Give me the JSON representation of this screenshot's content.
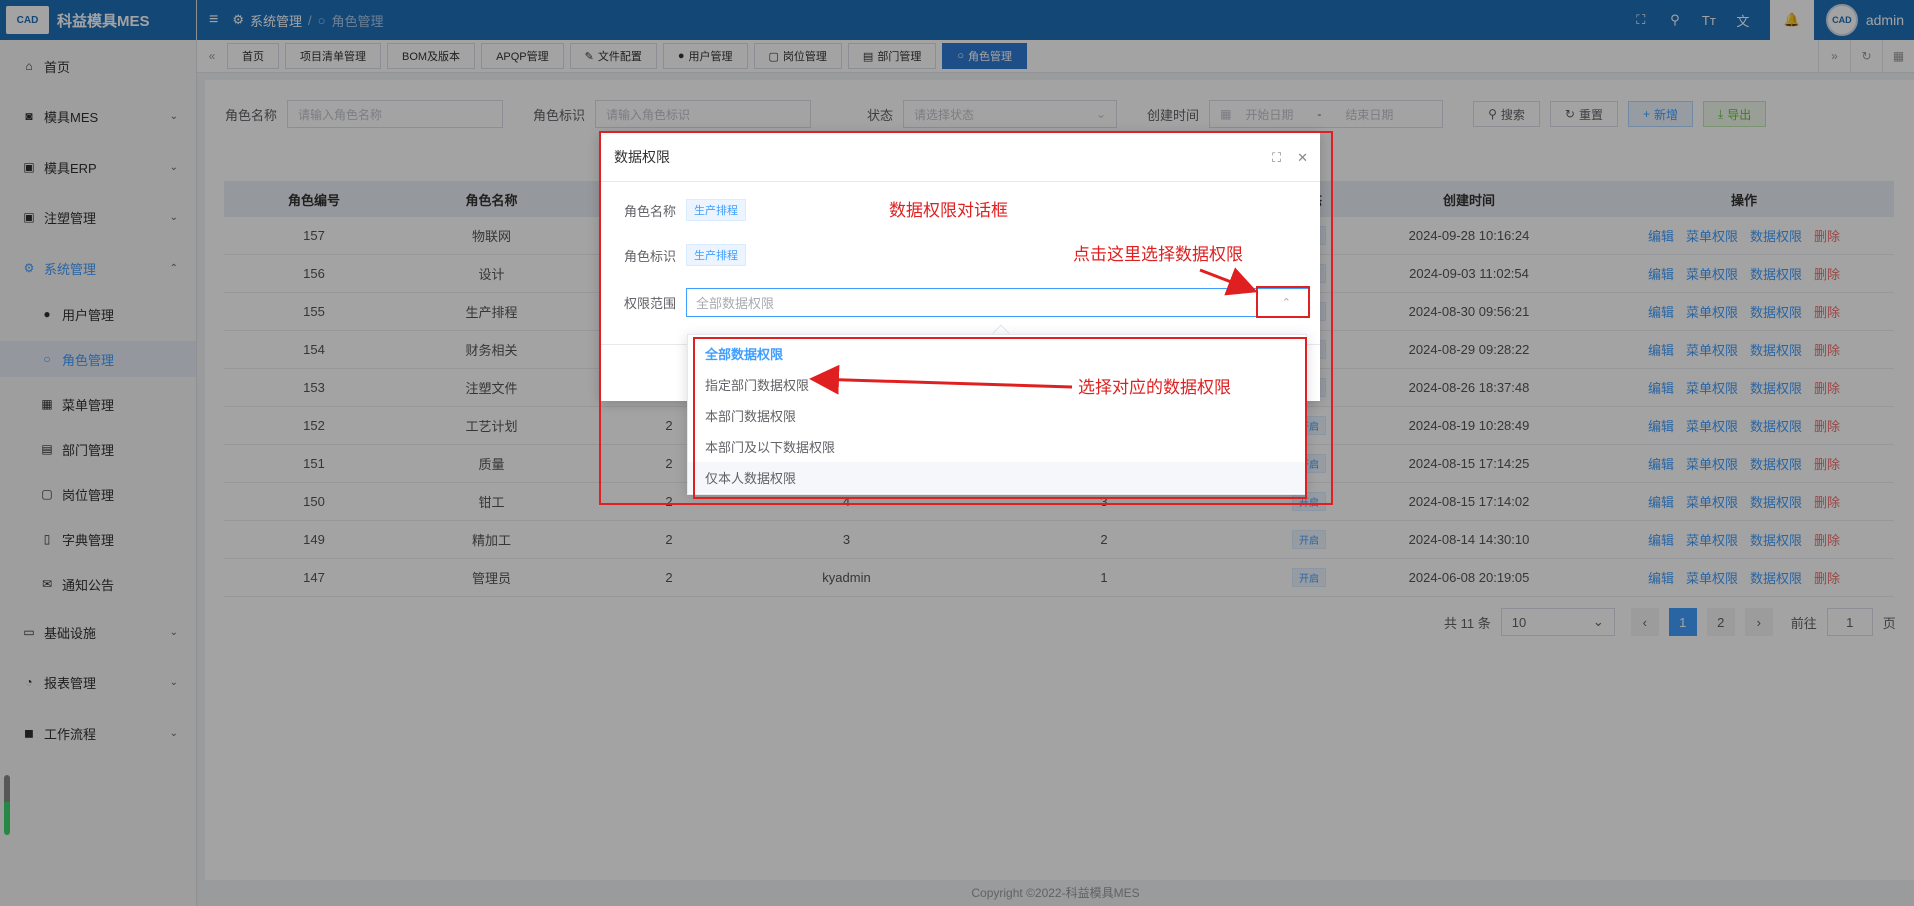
{
  "app": {
    "title": "科益模具MES",
    "logo_text": "CAD"
  },
  "topbar": {
    "breadcrumb": [
      "系统管理",
      "角色管理"
    ],
    "user": "admin",
    "icons": [
      "fullscreen-icon",
      "search-icon",
      "font-size-icon",
      "translate-icon",
      "bell-icon"
    ]
  },
  "sidebar": {
    "items": [
      {
        "label": "首页",
        "icon": "home-icon"
      },
      {
        "label": "模具MES",
        "icon": "camera-icon"
      },
      {
        "label": "模具ERP",
        "icon": "briefcase-icon"
      },
      {
        "label": "注塑管理",
        "icon": "briefcase-icon"
      },
      {
        "label": "系统管理",
        "icon": "gear-icon"
      },
      {
        "label": "用户管理",
        "icon": "user-icon"
      },
      {
        "label": "角色管理",
        "icon": "user-outline-icon"
      },
      {
        "label": "菜单管理",
        "icon": "grid-icon"
      },
      {
        "label": "部门管理",
        "icon": "id-card-icon"
      },
      {
        "label": "岗位管理",
        "icon": "badge-icon"
      },
      {
        "label": "字典管理",
        "icon": "book-icon"
      },
      {
        "label": "通知公告",
        "icon": "message-icon"
      },
      {
        "label": "基础设施",
        "icon": "monitor-icon"
      },
      {
        "label": "报表管理",
        "icon": "chart-icon"
      },
      {
        "label": "工作流程",
        "icon": "flow-icon"
      }
    ]
  },
  "tabs": [
    {
      "label": "首页"
    },
    {
      "label": "项目清单管理"
    },
    {
      "label": "BOM及版本"
    },
    {
      "label": "APQP管理"
    },
    {
      "label": "文件配置"
    },
    {
      "label": "用户管理"
    },
    {
      "label": "岗位管理"
    },
    {
      "label": "部门管理"
    },
    {
      "label": "角色管理"
    }
  ],
  "search": {
    "role_name_label": "角色名称",
    "role_name_placeholder": "请输入角色名称",
    "role_key_label": "角色标识",
    "role_key_placeholder": "请输入角色标识",
    "status_label": "状态",
    "status_placeholder": "请选择状态",
    "created_label": "创建时间",
    "start_placeholder": "开始日期",
    "dash": "-",
    "end_placeholder": "结束日期",
    "search_btn": "搜索",
    "reset_btn": "重置",
    "add_btn": "新增",
    "export_btn": "导出"
  },
  "table": {
    "headers": [
      "角色编号",
      "角色名称",
      "",
      "",
      "",
      "状态",
      "创建时间",
      "操作"
    ],
    "rows": [
      {
        "id": "157",
        "name": "物联网",
        "c3": "",
        "c4": "",
        "c5": "",
        "status": "开启",
        "created": "2024-09-28 10:16:24"
      },
      {
        "id": "156",
        "name": "设计",
        "c3": "",
        "c4": "",
        "c5": "",
        "status": "开启",
        "created": "2024-09-03 11:02:54"
      },
      {
        "id": "155",
        "name": "生产排程",
        "c3": "",
        "c4": "",
        "c5": "",
        "status": "开启",
        "created": "2024-08-30 09:56:21"
      },
      {
        "id": "154",
        "name": "财务相关",
        "c3": "",
        "c4": "",
        "c5": "",
        "status": "开启",
        "created": "2024-08-29 09:28:22"
      },
      {
        "id": "153",
        "name": "注塑文件",
        "c3": "",
        "c4": "",
        "c5": "",
        "status": "开启",
        "created": "2024-08-26 18:37:48"
      },
      {
        "id": "152",
        "name": "工艺计划",
        "c3": "2",
        "c4": "",
        "c5": "",
        "status": "开启",
        "created": "2024-08-19 10:28:49"
      },
      {
        "id": "151",
        "name": "质量",
        "c3": "2",
        "c4": "",
        "c5": "",
        "status": "开启",
        "created": "2024-08-15 17:14:25"
      },
      {
        "id": "150",
        "name": "钳工",
        "c3": "2",
        "c4": "4",
        "c5": "3",
        "status": "开启",
        "created": "2024-08-15 17:14:02"
      },
      {
        "id": "149",
        "name": "精加工",
        "c3": "2",
        "c4": "3",
        "c5": "2",
        "status": "开启",
        "created": "2024-08-14 14:30:10"
      },
      {
        "id": "147",
        "name": "管理员",
        "c3": "2",
        "c4": "kyadmin",
        "c5": "1",
        "status": "开启",
        "created": "2024-06-08 20:19:05"
      }
    ],
    "ops": [
      "编辑",
      "菜单权限",
      "数据权限",
      "删除"
    ]
  },
  "pager": {
    "total": "共 11 条",
    "page_size": "10",
    "pages": [
      "1",
      "2"
    ],
    "goto_label": "前往",
    "goto_value": "1",
    "page_suffix": "页"
  },
  "copyright": "Copyright ©2022-科益模具MES",
  "dialog": {
    "title": "数据权限",
    "role_name_label": "角色名称",
    "role_name_value": "生产排程",
    "role_key_label": "角色标识",
    "role_key_value": "生产排程",
    "scope_label": "权限范围",
    "scope_value": "全部数据权限",
    "options": [
      "全部数据权限",
      "指定部门数据权限",
      "本部门数据权限",
      "本部门及以下数据权限",
      "仅本人数据权限"
    ]
  },
  "annotations": {
    "dialog_note": "数据权限对话框",
    "click_note": "点击这里选择数据权限",
    "select_note": "选择对应的数据权限"
  },
  "colors": {
    "brand": "#1f6fb9",
    "accent": "#409eff",
    "annotation": "#e02020",
    "danger": "#f56c6c"
  }
}
